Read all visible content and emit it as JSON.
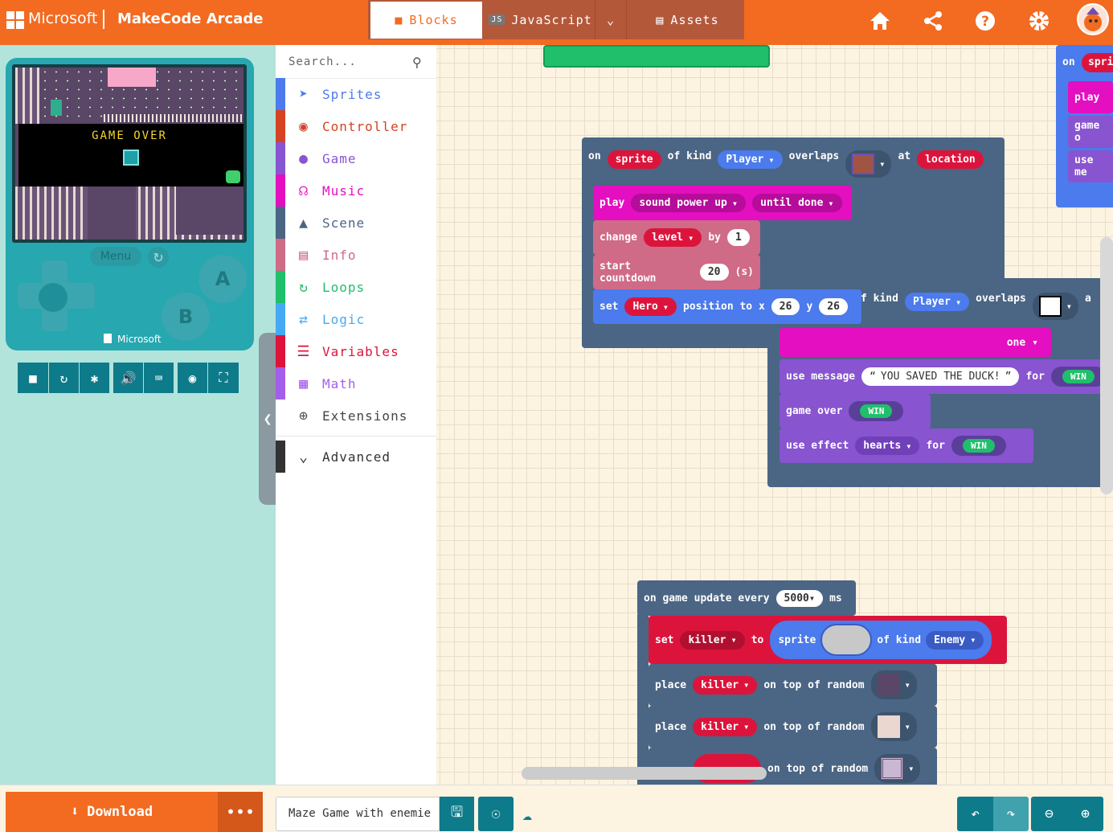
{
  "header": {
    "brand": "Microsoft",
    "product": "MakeCode Arcade",
    "tabs": [
      {
        "label": "Blocks",
        "icon": "puzzle-icon",
        "active": true
      },
      {
        "label": "JavaScript",
        "icon": "js-icon",
        "active": false
      },
      {
        "label": "Assets",
        "icon": "image-icon",
        "active": false
      }
    ],
    "icons": [
      "home-icon",
      "share-icon",
      "help-icon",
      "gear-icon",
      "avatar"
    ]
  },
  "simulator": {
    "screen_text": "GAME OVER",
    "menu_label": "Menu",
    "button_a": "A",
    "button_b": "B",
    "brand": "Microsoft",
    "tools": [
      "stop-icon",
      "restart-icon",
      "debug-icon",
      "sound-icon",
      "keyboard-icon",
      "screenshot-icon",
      "fullscreen-icon"
    ]
  },
  "toolbox": {
    "search_placeholder": "Search...",
    "categories": [
      {
        "label": "Sprites",
        "color": "#4b7bec"
      },
      {
        "label": "Controller",
        "color": "#d54322"
      },
      {
        "label": "Game",
        "color": "#8854d0"
      },
      {
        "label": "Music",
        "color": "#e30fc0"
      },
      {
        "label": "Scene",
        "color": "#4b6584"
      },
      {
        "label": "Info",
        "color": "#cf6a87"
      },
      {
        "label": "Loops",
        "color": "#20bf6b"
      },
      {
        "label": "Logic",
        "color": "#45aaf2"
      },
      {
        "label": "Variables",
        "color": "#dc143c"
      },
      {
        "label": "Math",
        "color": "#a55eea"
      },
      {
        "label": "Extensions",
        "color": "#444444"
      },
      {
        "label": "Advanced",
        "color": "#333333"
      }
    ]
  },
  "workspace": {
    "overlap_block": {
      "on": "on",
      "sprite": "sprite",
      "of_kind": "of kind",
      "kind": "Player",
      "overlaps": "overlaps",
      "at": "at",
      "location": "location"
    },
    "play_block": {
      "play": "play",
      "sound": "sound power up",
      "mode": "until done"
    },
    "change_block": {
      "change": "change",
      "var": "level",
      "by": "by",
      "value": "1"
    },
    "countdown_block": {
      "label": "start countdown",
      "value": "20",
      "unit": "(s)"
    },
    "setpos_block": {
      "set": "set",
      "sprite": "Hero",
      "label": "position to x",
      "x": "26",
      "y_label": "y",
      "y": "26"
    },
    "second_overlap": {
      "kind_label": "f kind",
      "kind": "Player",
      "overlaps": "overlaps",
      "tail": "a"
    },
    "done_fragment": "one",
    "message_block": {
      "label": "use message",
      "text": "YOU SAVED THE DUCK!",
      "for": "for",
      "win": "WIN"
    },
    "gameover_block": {
      "label": "game over",
      "win": "WIN"
    },
    "effect_block": {
      "label": "use effect",
      "effect": "hearts",
      "for": "for",
      "win": "WIN"
    },
    "update_block": {
      "label": "on game update every",
      "value": "5000",
      "unit": "ms"
    },
    "set_killer": {
      "set": "set",
      "var": "killer",
      "to": "to",
      "sprite": "sprite",
      "of_kind": "of kind",
      "kind": "Enemy"
    },
    "place_rows": [
      {
        "place": "place",
        "var": "killer",
        "label": "on top of random"
      },
      {
        "place": "place",
        "var": "killer",
        "label": "on top of random"
      },
      {
        "place": "",
        "var": "",
        "label": "on top of random"
      }
    ],
    "top_right": {
      "on": "on",
      "spri": "spri",
      "play": "play",
      "game": "game o",
      "use": "use me"
    }
  },
  "bottom": {
    "download": "Download",
    "more": "•••",
    "project_name": "Maze Game with enemie"
  },
  "colors": {
    "header": "#f26b21",
    "sprites": "#4b7bec",
    "music": "#e30fc0",
    "info": "#cf6a87",
    "scene": "#4b6584",
    "variables": "#dc143c",
    "game": "#8854d0",
    "teal": "#0e7b8a"
  }
}
